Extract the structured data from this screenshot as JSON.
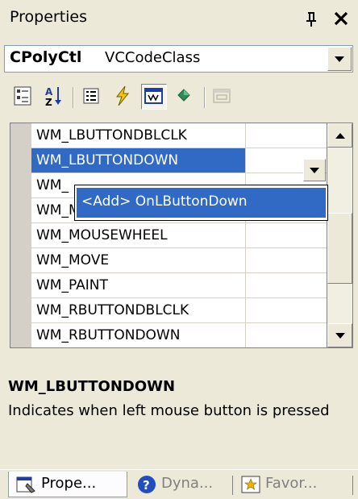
{
  "panel": {
    "title": "Properties"
  },
  "object_selector": {
    "name": "CPolyCtl",
    "type": "VCCodeClass"
  },
  "toolbar": {
    "buttons": [
      {
        "icon": "categorized-icon"
      },
      {
        "icon": "alphabetical-icon"
      },
      {
        "icon": "properties-icon"
      },
      {
        "icon": "events-icon"
      },
      {
        "icon": "messages-icon",
        "pressed": true
      },
      {
        "icon": "overrides-icon"
      },
      {
        "icon": "property-pages-icon",
        "disabled": true
      }
    ]
  },
  "grid": {
    "rows": [
      {
        "name": "WM_LBUTTONDBLCLK"
      },
      {
        "name": "WM_LBUTTONDOWN",
        "selected": true
      },
      {
        "name": "WM_"
      },
      {
        "name": "WM_MOUSEMOVE"
      },
      {
        "name": "WM_MOUSEWHEEL"
      },
      {
        "name": "WM_MOVE"
      },
      {
        "name": "WM_PAINT"
      },
      {
        "name": "WM_RBUTTONDBLCLK"
      },
      {
        "name": "WM_RBUTTONDOWN"
      }
    ],
    "dropdown_option": "<Add> OnLButtonDown"
  },
  "description": {
    "title": "WM_LBUTTONDOWN",
    "text": "Indicates when left mouse button is pressed"
  },
  "tabs": [
    {
      "label": "Prope...",
      "icon": "properties-window-icon",
      "active": true
    },
    {
      "label": "Dyna...",
      "icon": "help-icon"
    },
    {
      "label": "Favor...",
      "icon": "favorites-icon"
    }
  ],
  "colors": {
    "selection": "#316AC5",
    "background": "#ECE9D8"
  }
}
